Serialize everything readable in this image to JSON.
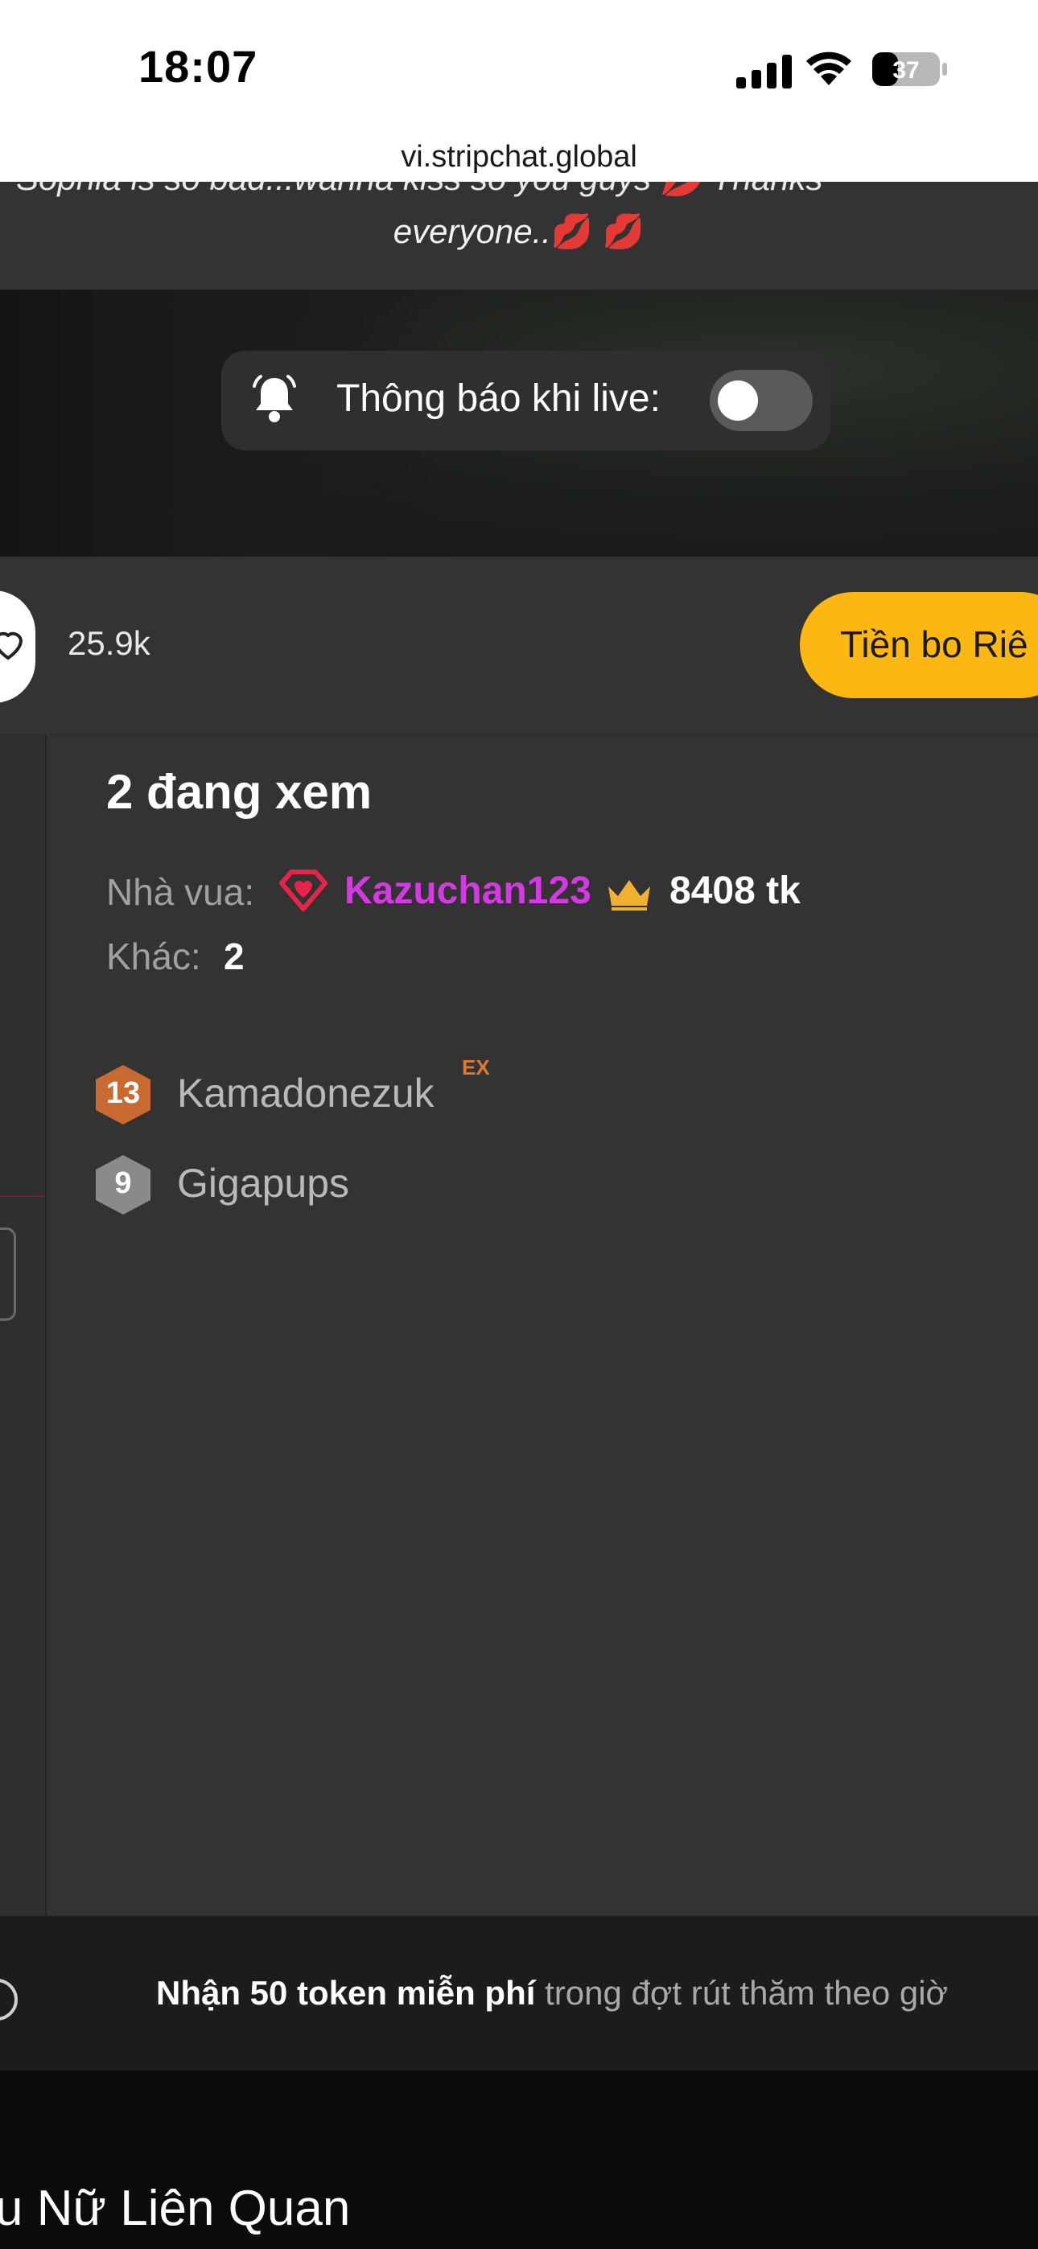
{
  "status_bar": {
    "time": "18:07",
    "battery_level": "37",
    "icons": [
      "cellular-signal-icon",
      "wifi-icon",
      "battery-icon"
    ]
  },
  "browser": {
    "url": "vi.stripchat.global"
  },
  "bio": {
    "line1": "Sophia is so bad...wanna kiss so you guys 💋 Thanks",
    "line2": "everyone..",
    "line2_emoji": "💋 💋"
  },
  "notification": {
    "label": "Thông báo khi live:",
    "toggle_on": false
  },
  "actions": {
    "like_count": "25.9k",
    "tip_button_label": "Tiền bo Riê"
  },
  "viewers": {
    "title": "2 đang xem",
    "king_label": "Nhà vua:",
    "king_name": "Kazuchan123",
    "king_tokens": "8408 tk",
    "other_label": "Khác:",
    "other_count": "2",
    "users": [
      {
        "level": "13",
        "name": "Kamadonezuk",
        "tag": "EX",
        "badge_color": "#c96a32"
      },
      {
        "level": "9",
        "name": "Gigapups",
        "tag": "",
        "badge_color": "#8a8a8a"
      }
    ]
  },
  "promo": {
    "strong": "Nhận 50 token miễn phí",
    "rest": " trong đợt rút thăm theo giờ"
  },
  "section": {
    "title": "u Nữ Liên Quan"
  },
  "colors": {
    "accent_tip": "#fdb713",
    "king_name": "#d638e6",
    "heart": "#e8234a",
    "crown": "#f0b030"
  }
}
